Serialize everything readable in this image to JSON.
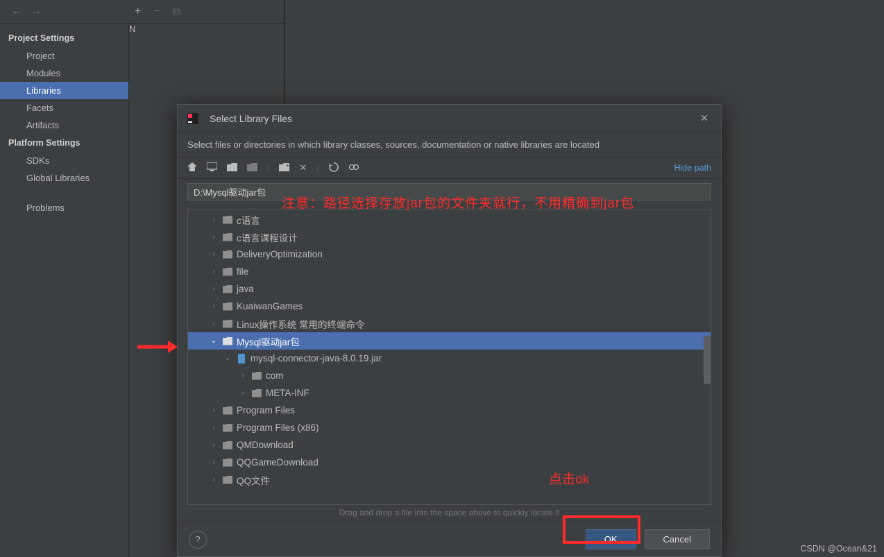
{
  "topbar": {
    "back": "←",
    "forward": "→"
  },
  "sidebar": {
    "heading1": "Project Settings",
    "items1": [
      "Project",
      "Modules",
      "Libraries",
      "Facets",
      "Artifacts"
    ],
    "selected1": 2,
    "heading2": "Platform Settings",
    "items2": [
      "SDKs",
      "Global Libraries"
    ],
    "heading3": "",
    "items3": [
      "Problems"
    ]
  },
  "panel2_toolbar": {
    "add": "+",
    "remove": "−",
    "copy": "⧉"
  },
  "dialog": {
    "title": "Select Library Files",
    "desc": "Select files or directories in which library classes, sources, documentation or native libraries are located",
    "toolbar": {
      "home": "⌂",
      "desktop": "🖵",
      "folder": "📁",
      "folder2": "📂",
      "sep": "|",
      "new": "✎",
      "del": "✕",
      "sep2": "|",
      "refresh": "⟳",
      "toggle": "⇆"
    },
    "hide_path": "Hide path",
    "path": "D:\\Mysql驱动jar包",
    "tree": [
      {
        "d": 0,
        "chev": ">",
        "t": "folder",
        "label": "c语言"
      },
      {
        "d": 0,
        "chev": ">",
        "t": "folder",
        "label": "c语言课程设计"
      },
      {
        "d": 0,
        "chev": ">",
        "t": "folder",
        "label": "DeliveryOptimization"
      },
      {
        "d": 0,
        "chev": ">",
        "t": "folder",
        "label": "file"
      },
      {
        "d": 0,
        "chev": ">",
        "t": "folder",
        "label": "java"
      },
      {
        "d": 0,
        "chev": ">",
        "t": "folder",
        "label": "KuaiwanGames"
      },
      {
        "d": 0,
        "chev": ">",
        "t": "folder",
        "label": "Linux操作系统 常用的终端命令"
      },
      {
        "d": 0,
        "chev": "v",
        "t": "folder",
        "label": "Mysql驱动jar包",
        "sel": true
      },
      {
        "d": 1,
        "chev": "v",
        "t": "jar",
        "label": "mysql-connector-java-8.0.19.jar"
      },
      {
        "d": 2,
        "chev": ">",
        "t": "folder",
        "label": "com"
      },
      {
        "d": 2,
        "chev": ">",
        "t": "folder",
        "label": "META-INF"
      },
      {
        "d": 0,
        "chev": ">",
        "t": "folder",
        "label": "Program Files"
      },
      {
        "d": 0,
        "chev": ">",
        "t": "folder",
        "label": "Program Files (x86)"
      },
      {
        "d": 0,
        "chev": ">",
        "t": "folder",
        "label": "QMDownload"
      },
      {
        "d": 0,
        "chev": ">",
        "t": "folder",
        "label": "QQGameDownload"
      },
      {
        "d": 0,
        "chev": ">",
        "t": "folder",
        "label": "QQ文件"
      }
    ],
    "hint": "Drag and drop a file into the space above to quickly locate it",
    "ok": "OK",
    "cancel": "Cancel"
  },
  "annotations": {
    "path_note": "注意：路径选择存放jar包的文件夹就行，不用精确到jar包",
    "click_ok": "点击ok"
  },
  "watermark": "CSDN @Ocean&21"
}
